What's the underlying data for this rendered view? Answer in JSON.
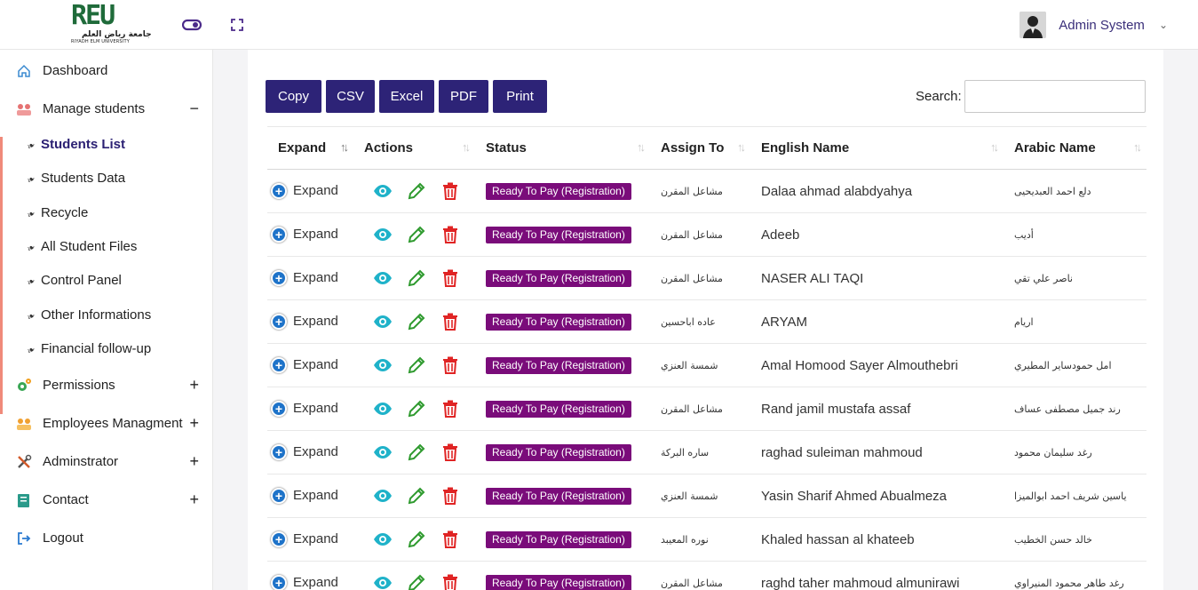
{
  "header": {
    "logo": {
      "mark": "REU",
      "arabic": "جامعة رياض العلم",
      "english": "RIYADH ELM UNIVERSITY"
    },
    "user_name": "Admin System",
    "toggle_icon": "toggle-icon",
    "fullscreen_icon": "fullscreen-icon"
  },
  "sidebar": {
    "items": [
      {
        "label": "Dashboard",
        "icon": "home-icon",
        "toggle": ""
      },
      {
        "label": "Manage students",
        "icon": "students-icon",
        "toggle": "−"
      },
      {
        "label": "Permissions",
        "icon": "gears-icon",
        "toggle": "+"
      },
      {
        "label": "Employees Managment",
        "icon": "employees-icon",
        "toggle": "+"
      },
      {
        "label": "Adminstrator",
        "icon": "tools-icon",
        "toggle": "+"
      },
      {
        "label": "Contact",
        "icon": "contact-icon",
        "toggle": "+"
      },
      {
        "label": "Logout",
        "icon": "logout-icon",
        "toggle": ""
      }
    ],
    "sub_items": [
      {
        "label": "Students List",
        "active": true
      },
      {
        "label": "Students Data"
      },
      {
        "label": "Recycle"
      },
      {
        "label": "All Student Files"
      },
      {
        "label": "Control Panel"
      },
      {
        "label": "Other Informations"
      },
      {
        "label": "Financial follow-up"
      }
    ]
  },
  "toolbar": {
    "buttons": [
      "Copy",
      "CSV",
      "Excel",
      "PDF",
      "Print"
    ],
    "search_label": "Search:",
    "search_value": ""
  },
  "table": {
    "columns": [
      "Expand",
      "Actions",
      "Status",
      "Assign To",
      "English Name",
      "Arabic Name"
    ],
    "expand_label": "Expand",
    "rows": [
      {
        "status": "Ready To Pay (Registration)",
        "assign": "مشاعل المقرن",
        "en": "Dalaa ahmad alabdyahya",
        "ar": "دلع احمد العبديحيى"
      },
      {
        "status": "Ready To Pay (Registration)",
        "assign": "مشاعل المقرن",
        "en": "Adeeb",
        "ar": "أديب"
      },
      {
        "status": "Ready To Pay (Registration)",
        "assign": "مشاعل المقرن",
        "en": "NASER ALI TAQI",
        "ar": "ناصر علي تقي"
      },
      {
        "status": "Ready To Pay (Registration)",
        "assign": "عاده اباحسين",
        "en": "ARYAM",
        "ar": "اريام"
      },
      {
        "status": "Ready To Pay (Registration)",
        "assign": "شمسة العنزي",
        "en": "Amal Homood Sayer Almouthebri",
        "ar": "امل حمودساير المطيري"
      },
      {
        "status": "Ready To Pay (Registration)",
        "assign": "مشاعل المقرن",
        "en": "Rand jamil mustafa assaf",
        "ar": "رند جميل مصطفى عساف"
      },
      {
        "status": "Ready To Pay (Registration)",
        "assign": "ساره البركة",
        "en": "raghad suleiman mahmoud",
        "ar": "رغد سليمان محمود"
      },
      {
        "status": "Ready To Pay (Registration)",
        "assign": "شمسة العنزي",
        "en": "Yasin Sharif Ahmed Abualmeza",
        "ar": "ياسين شريف احمد ابوالميزا"
      },
      {
        "status": "Ready To Pay (Registration)",
        "assign": "نوره المعيبد",
        "en": "Khaled hassan al khateeb",
        "ar": "خالد حسن الخطيب"
      },
      {
        "status": "Ready To Pay (Registration)",
        "assign": "مشاعل المقرن",
        "en": "raghd taher mahmoud almunirawi",
        "ar": "رغد طاهر محمود المنيراوي"
      }
    ]
  },
  "colors": {
    "primary": "#2d2377",
    "badge": "#7a0c7a",
    "view_icon": "#1fb2c9",
    "edit_icon": "#2e9a2e",
    "delete_icon": "#e02424",
    "accent_bar": "#f08a7a"
  }
}
